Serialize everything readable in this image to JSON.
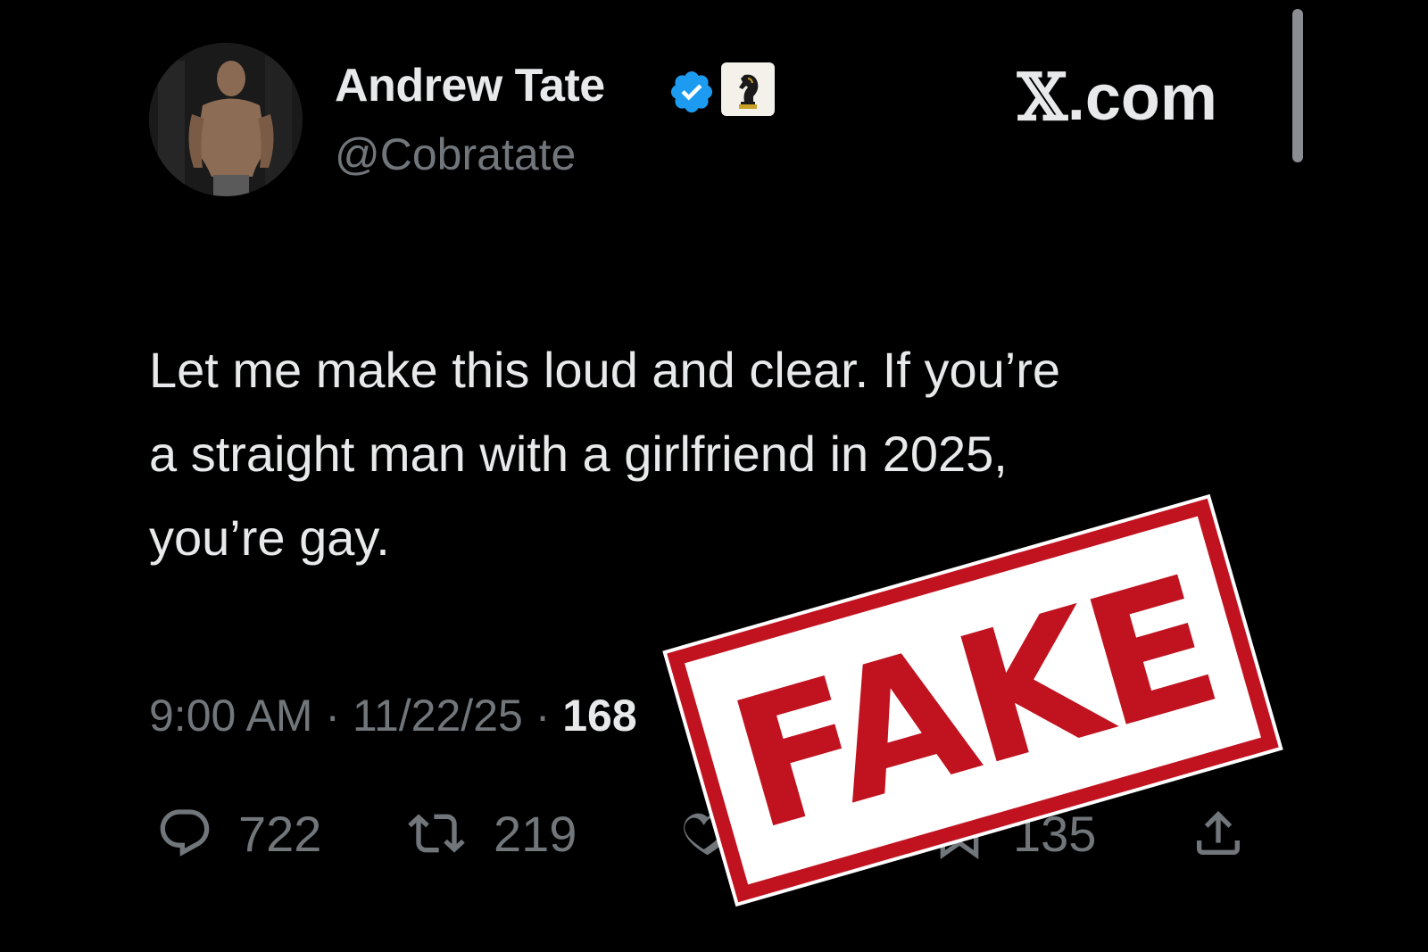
{
  "account": {
    "display_name": "Andrew Tate",
    "handle": "@Cobratate",
    "verified": true
  },
  "site": {
    "x_glyph": "𝕏",
    "suffix": ".com"
  },
  "tweet": {
    "lines": [
      "Let me make this loud and clear. If you’re",
      "a straight man with a girlfriend in 2025,",
      "you’re gay."
    ],
    "time": "9:00 AM",
    "separator": " · ",
    "date": "11/22/25",
    "views_partial": "168"
  },
  "actions": {
    "replies": "722",
    "reposts": "219",
    "bookmarks": "135"
  },
  "stamp": {
    "text": "FAKE"
  },
  "colors": {
    "background": "#000000",
    "text_primary": "#e7e9ea",
    "text_secondary": "#71767b",
    "verified": "#1d9bf0",
    "stamp_red": "#c1121f"
  },
  "icons": [
    "verified-icon",
    "affiliate-badge-icon",
    "reply-icon",
    "repost-icon",
    "like-icon",
    "bookmark-icon",
    "share-icon"
  ]
}
